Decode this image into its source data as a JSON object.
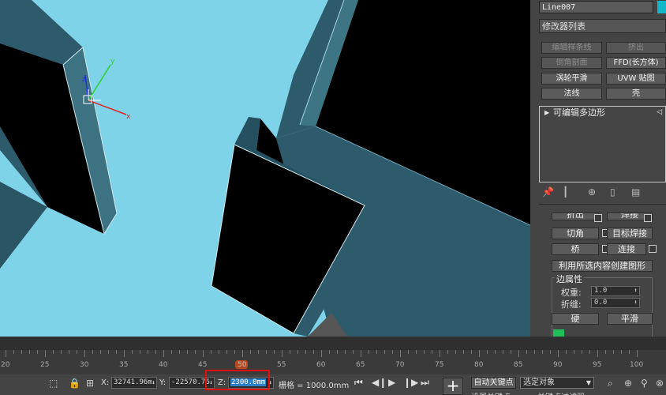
{
  "command_panel": {
    "object_name": "Line007",
    "modifier_list": "修改器列表",
    "modifier_buttons": [
      "编辑样条线",
      "挤出",
      "倒角剖面",
      "FFD(长方体)",
      "涡轮平滑",
      "UVW 贴图",
      "法线",
      "壳"
    ],
    "stack_item": "可编辑多边形",
    "rollout_partial": [
      "折出",
      "焊接"
    ],
    "rollout": {
      "cut": "切角",
      "target_weld": "目标焊接",
      "bridge": "桥",
      "connect": "连接",
      "create_shape": "利用所选内容创建图形",
      "edge_props": "边属性",
      "weight_label": "权重:",
      "weight_value": "1.0",
      "crease_label": "折缝:",
      "crease_value": "0.0",
      "hard": "硬",
      "smooth": "平滑"
    }
  },
  "timeline": {
    "ticks": [
      "20",
      "25",
      "30",
      "35",
      "40",
      "45",
      "50",
      "55",
      "60",
      "65",
      "70",
      "75",
      "80",
      "85",
      "90",
      "95",
      "100"
    ],
    "current_frame": "50"
  },
  "statusbar": {
    "x_label": "X:",
    "x_value": "32741.96m",
    "y_label": "Y:",
    "y_value": "-22570.76",
    "z_label": "Z:",
    "z_value": "2300.0mm",
    "grid_text": "栅格 = 1000.0mm",
    "auto_key": "自动关键点",
    "selected_object": "选定对象",
    "set_key_partial": "设置关键点",
    "filter_partial": "关键点过滤器"
  },
  "colors": {
    "viewport_bg": "#7fd3e8",
    "wall": "#2e5b6c",
    "wall_dark": "#1f4453",
    "object_color": "#13b7c8",
    "accent_red": "#e01010"
  }
}
